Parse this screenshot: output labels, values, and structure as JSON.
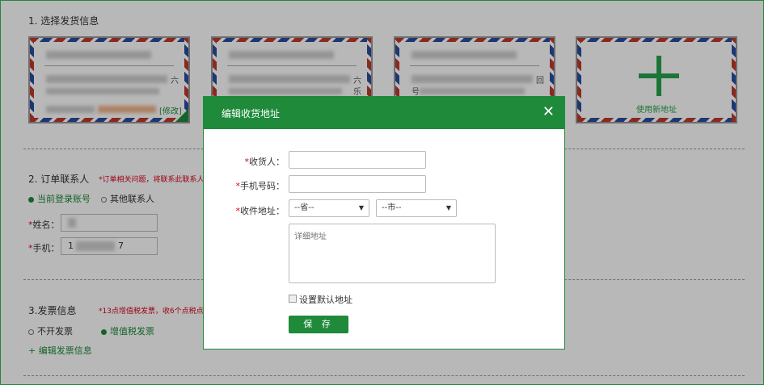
{
  "sections": {
    "shipping_title": "1. 选择发货信息",
    "contact_title": "2. 订单联系人",
    "contact_note": "*订单相关问题，将联系此联系人",
    "invoice_title": "3.发票信息",
    "invoice_note": "*13点增值税发票，收6个点税点"
  },
  "addresses": [
    {
      "side": "六",
      "edit_label": "[修改]"
    },
    {
      "side": "六",
      "side2": "乐"
    },
    {
      "side": "回",
      "side2": "号"
    }
  ],
  "add_address": {
    "label": "使用新地址"
  },
  "contact": {
    "radio_current": "当前登录账号",
    "radio_other": "其他联系人",
    "name_label": "姓名：",
    "phone_label": "手机：",
    "phone_prefix": "1",
    "phone_suffix": "7"
  },
  "invoice": {
    "radio_none": "不开发票",
    "radio_vat": "增值税发票",
    "edit_link": "+ 编辑发票信息"
  },
  "modal": {
    "title": "编辑收货地址",
    "close": "✕",
    "receiver_label": "收货人：",
    "phone_label": "手机号码：",
    "address_label": "收件地址：",
    "province_placeholder": "--省--",
    "city_placeholder": "--市--",
    "detail_placeholder": "详细地址",
    "default_label": "设置默认地址",
    "save_label": "保 存"
  },
  "colors": {
    "accent": "#1e8a3a",
    "required": "#d9001b"
  }
}
